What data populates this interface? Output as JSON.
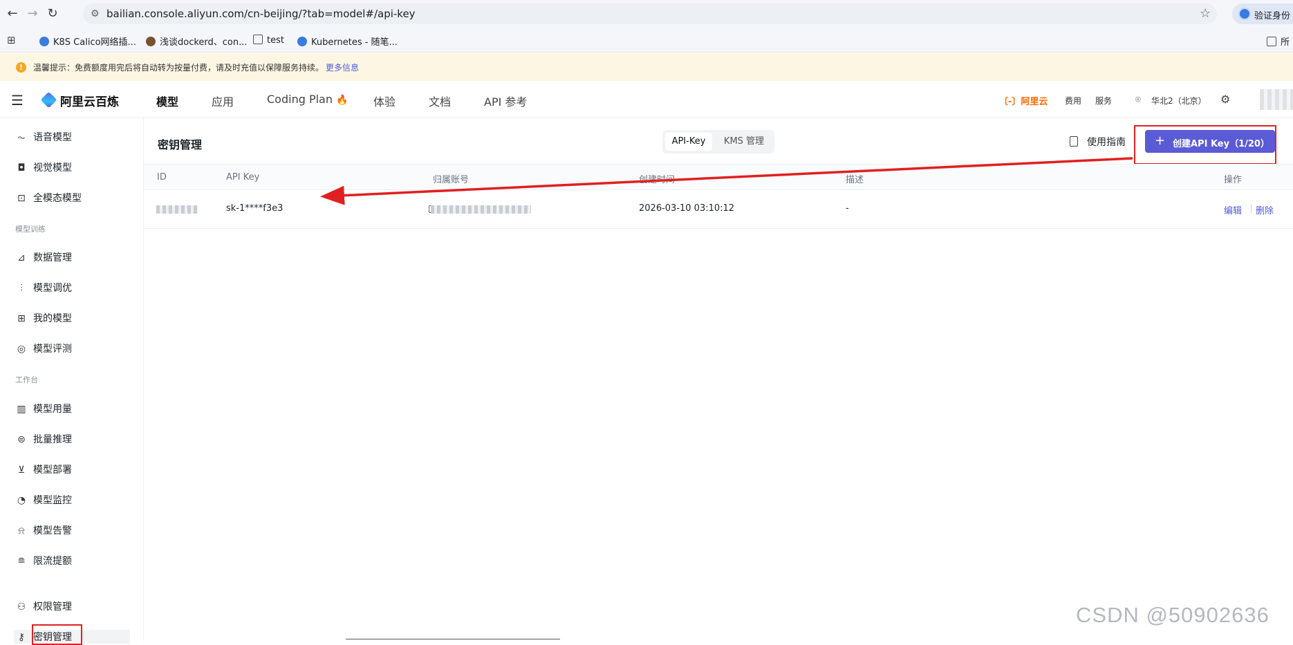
{
  "browser": {
    "url": "bailian.console.aliyun.com/cn-beijing/?tab=model#/api-key",
    "profile_label": "验证身份",
    "bookmarks": [
      "K8S Calico网络插...",
      "浅谈dockerd、con...",
      "test",
      "Kubernetes - 随笔..."
    ],
    "bookmarks_right": "所"
  },
  "notice": {
    "text": "温馨提示：免费额度用完后将自动转为按量付费，请及时充值以保障服务持续。",
    "link": "更多信息"
  },
  "header": {
    "logo": "阿里云百炼",
    "nav": [
      "模型",
      "应用",
      "Coding Plan",
      "体验",
      "文档",
      "API 参考"
    ],
    "coding_plan_emoji": "🔥",
    "aliyun": "〔-〕阿里云",
    "fee": "费用",
    "service": "服务",
    "region": "华北2（北京）"
  },
  "sidebar": {
    "items_top": [
      {
        "label": "语音模型",
        "icon": "waveform-icon"
      },
      {
        "label": "视觉模型",
        "icon": "camera-icon"
      },
      {
        "label": "全模态模型",
        "icon": "multimodal-icon"
      }
    ],
    "group_training": "模型训练",
    "items_training": [
      {
        "label": "数据管理",
        "icon": "chart-icon"
      },
      {
        "label": "模型调优",
        "icon": "sliders-icon"
      },
      {
        "label": "我的模型",
        "icon": "grid-icon"
      },
      {
        "label": "模型评测",
        "icon": "compass-icon"
      }
    ],
    "group_workbench": "工作台",
    "items_workbench": [
      {
        "label": "模型用量",
        "icon": "bar-chart-icon"
      },
      {
        "label": "批量推理",
        "icon": "list-icon"
      },
      {
        "label": "模型部署",
        "icon": "deploy-icon"
      },
      {
        "label": "模型监控",
        "icon": "pie-icon"
      },
      {
        "label": "模型告警",
        "icon": "alarm-icon"
      },
      {
        "label": "限流提额",
        "icon": "database-icon"
      }
    ],
    "items_bottom": [
      {
        "label": "权限管理",
        "icon": "user-icon"
      },
      {
        "label": "密钥管理",
        "icon": "key-icon"
      }
    ]
  },
  "page": {
    "title": "密钥管理",
    "tabs": [
      "API-Key",
      "KMS 管理"
    ],
    "guide": "使用指南",
    "create_button": "创建API Key（1/20）"
  },
  "table": {
    "columns": [
      "ID",
      "API Key",
      "归属账号",
      "创建时间",
      "描述",
      "操作"
    ],
    "rows": [
      {
        "api_key": "sk-1****f3e3",
        "created": "2026-03-10 03:10:12",
        "description": "-",
        "edit": "编辑",
        "delete": "删除"
      }
    ]
  },
  "watermark": "CSDN @50902636",
  "colors": {
    "accent": "#5b5bd6",
    "annotation_red": "#e02020",
    "brand_orange": "#ff6a00"
  }
}
